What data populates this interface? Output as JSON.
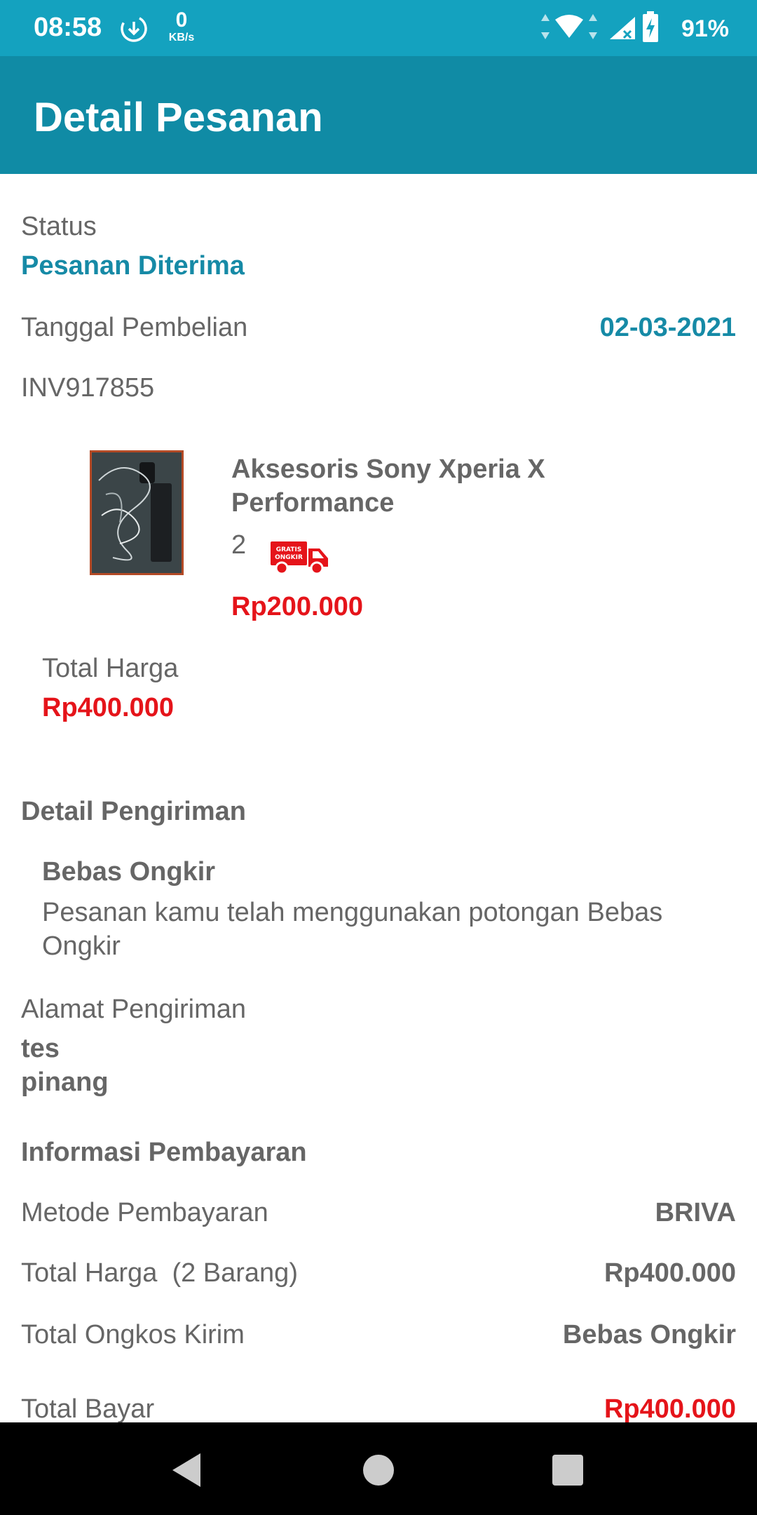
{
  "status_bar": {
    "time": "08:58",
    "net_speed_value": "0",
    "net_speed_unit": "KB/s",
    "battery_percent": "91%",
    "icons": [
      "download-icon",
      "wifi-icon",
      "signal-icon",
      "battery-charging-icon"
    ]
  },
  "app_bar": {
    "title": "Detail Pesanan"
  },
  "order": {
    "status_label": "Status",
    "status_value": "Pesanan Diterima",
    "purchase_date_label": "Tanggal Pembelian",
    "purchase_date_value": "02-03-2021",
    "invoice": "INV917855"
  },
  "product": {
    "name_line1": "Aksesoris Sony Xperia X",
    "name_line2": "Performance",
    "quantity": "2",
    "badge_text_1": "GRATIS",
    "badge_text_2": "ONGKIR",
    "price": "Rp200.000"
  },
  "total": {
    "label": "Total Harga",
    "value": "Rp400.000"
  },
  "shipping": {
    "section_title": "Detail Pengiriman",
    "method_title": "Bebas Ongkir",
    "method_desc_line1": "Pesanan kamu telah menggunakan potongan Bebas",
    "method_desc_line2": "Ongkir",
    "address_label": "Alamat Pengiriman",
    "address_line1": "tes",
    "address_line2": "pinang"
  },
  "payment": {
    "section_title": "Informasi Pembayaran",
    "rows": [
      {
        "label": "Metode Pembayaran",
        "value": "BRIVA"
      },
      {
        "label": "Total Harga  (2 Barang)",
        "value": "Rp400.000"
      },
      {
        "label": "Total Ongkos Kirim",
        "value": "Bebas Ongkir"
      }
    ],
    "partial_label": "Total Bayar",
    "partial_value": "Rp400.000"
  },
  "colors": {
    "status_bar": "#14a2bf",
    "app_bar": "#108ba5",
    "accent_teal": "#168aa6",
    "price_red": "#e5141a",
    "text_gray": "#666666"
  }
}
